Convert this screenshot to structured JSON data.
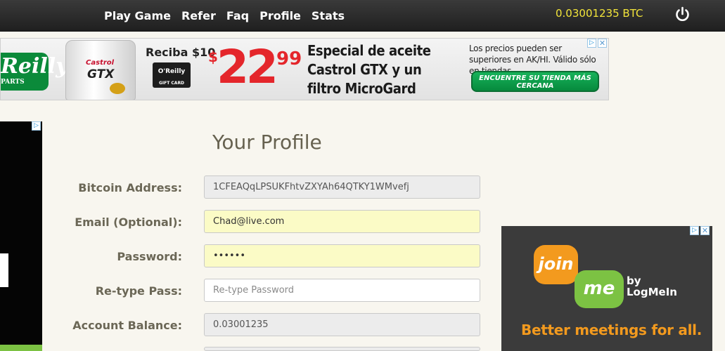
{
  "nav": {
    "items": [
      "Play Game",
      "Refer",
      "Faq",
      "Profile",
      "Stats"
    ],
    "balance": "0.03001235 BTC",
    "power_icon": "power-icon"
  },
  "banner_ad": {
    "logo_text": "Reilly",
    "logo_sub": "PARTS",
    "bottle_brand": "Castrol",
    "bottle_product": "GTX",
    "reciba": "Reciba $10",
    "gift_card_brand": "O'Reilly",
    "gift_card_label": "GIFT CARD",
    "price_dollar": "$",
    "price_whole": "22",
    "price_cents": "99",
    "headline": [
      "Especial de aceite",
      "Castrol GTX y un",
      "filtro MicroGard"
    ],
    "disclaimer": "Los precios pueden ser superiores en AK/HI. Válido sólo en tiendas.",
    "cta": "ENCUENTRE SU TIENDA MÁS CERCANA"
  },
  "profile": {
    "title": "Your Profile",
    "rows": [
      {
        "label": "Bitcoin Address:",
        "value": "1CFEAQqLPSUKFhtvZXYAh64QTKY1WMvefj",
        "placeholder": ""
      },
      {
        "label": "Email (Optional):",
        "value": "Chad@live.com",
        "placeholder": ""
      },
      {
        "label": "Password:",
        "value": "••••••",
        "placeholder": ""
      },
      {
        "label": "Re-type Pass:",
        "value": "",
        "placeholder": "Re-type Password"
      },
      {
        "label": "Account Balance:",
        "value": "0.03001235",
        "placeholder": ""
      }
    ]
  },
  "right_ad": {
    "join": "join",
    "me": "me",
    "by": "by",
    "logmein": "LogMeIn",
    "tagline": "Better meetings for all."
  },
  "colors": {
    "topbar": "#262626",
    "balance": "#f2e43a",
    "page_bg": "#f8f6ef",
    "filled_field": "#fbfbc6",
    "label": "#6b6756"
  }
}
